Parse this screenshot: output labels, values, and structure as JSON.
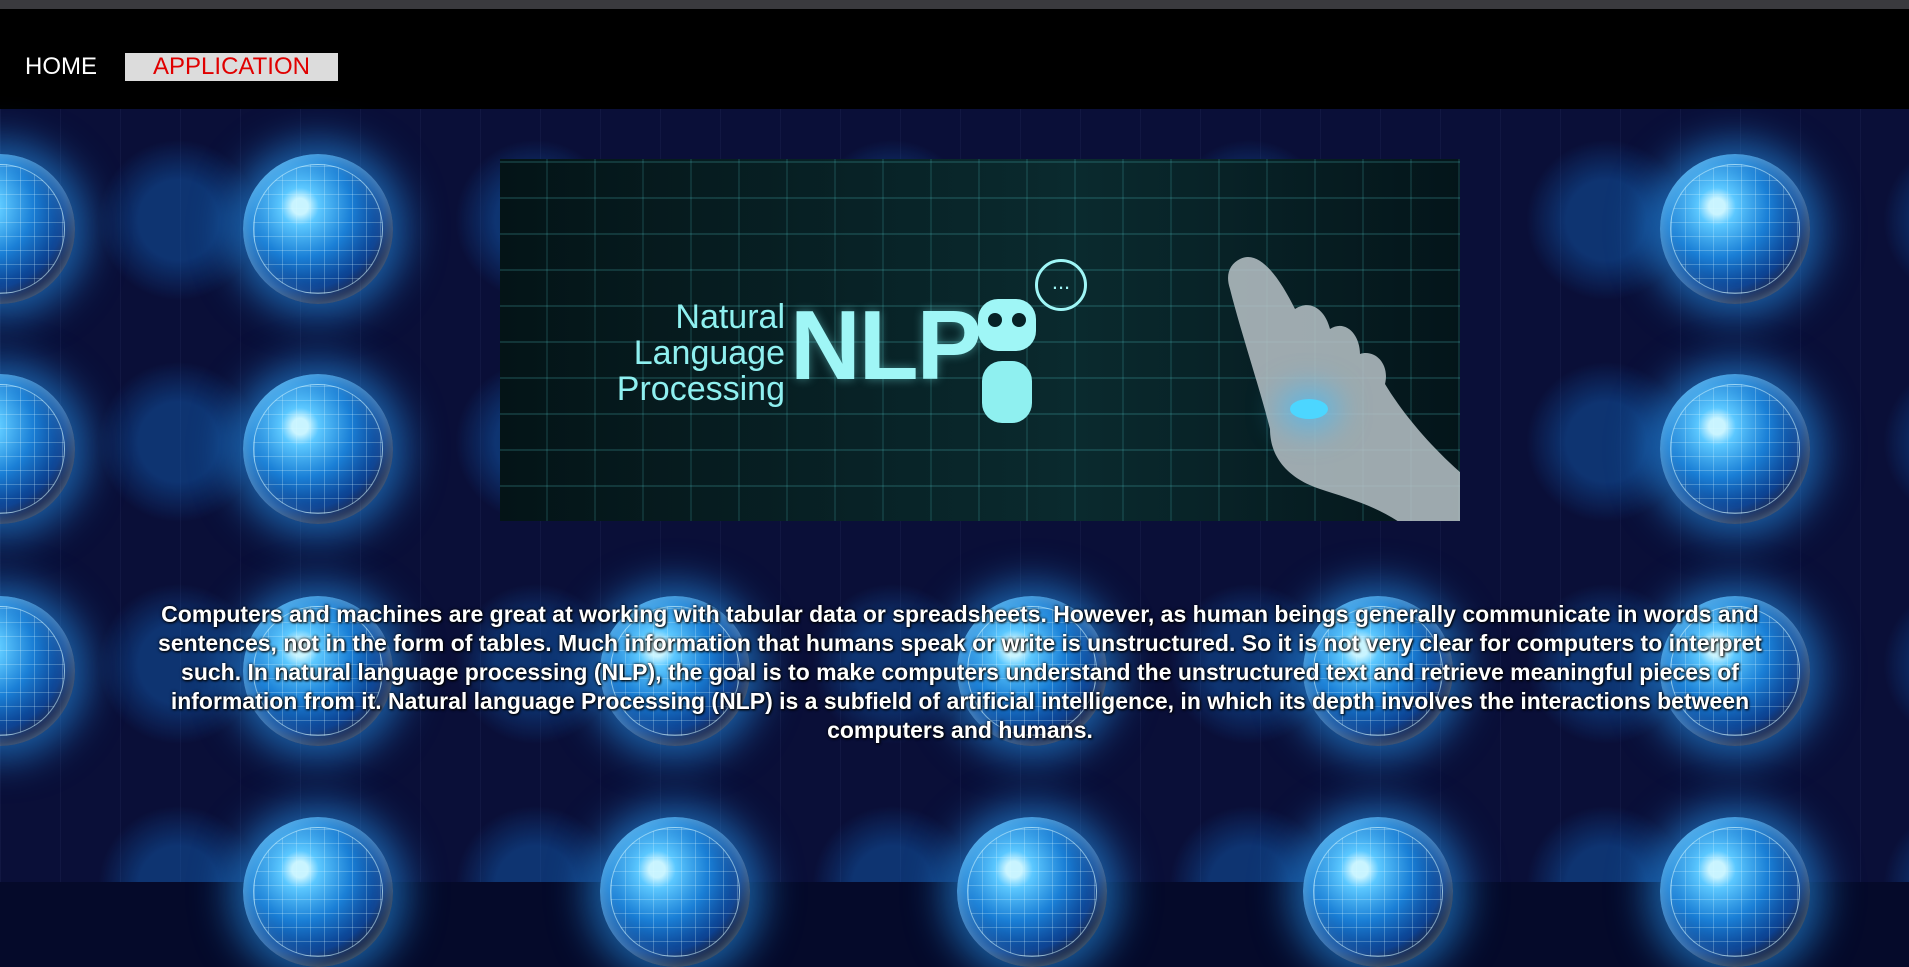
{
  "nav": {
    "home_label": "HOME",
    "application_label": "APPLICATION"
  },
  "banner": {
    "line1": "Natural",
    "line2": "Language",
    "line3": "Processing",
    "acronym": "NLP",
    "bubble": "..."
  },
  "content": {
    "description": "Computers and machines are great at working with tabular data or spreadsheets. However, as human beings generally communicate in words and sentences, not in the form of tables. Much information that humans speak or write is unstructured. So it is not very clear for computers to interpret such. In natural language processing (NLP), the goal is to make computers understand the unstructured text and retrieve meaningful pieces of information from it. Natural language Processing (NLP) is a subfield of artificial intelligence, in which its depth involves the interactions between computers and humans."
  },
  "colors": {
    "navbar_bg": "#000000",
    "home_text": "#ffffff",
    "application_text": "#e00000",
    "application_bg": "#dcdcdc",
    "background": "#0a0f38",
    "banner_accent": "#9ff6f6"
  },
  "icons": {
    "background_tile": "globe-icon",
    "banner_robot": "robot-icon",
    "banner_bubble": "chat-bubble-icon",
    "banner_hand": "hand-icon"
  }
}
